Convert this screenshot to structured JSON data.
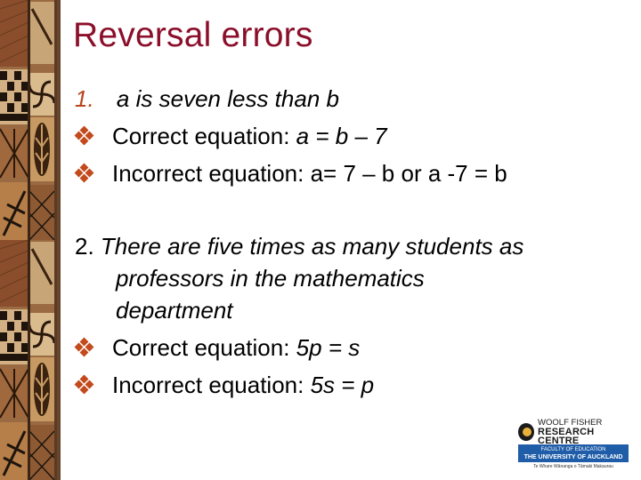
{
  "slide": {
    "title": "Reversal errors",
    "title_color": "#8b0f2a",
    "bullet_color": "#c24a1c",
    "item1": {
      "number": "1.",
      "statement": "a is seven less than b",
      "correct_label": "Correct equation: ",
      "correct_eq": "a = b – 7",
      "incorrect_label": "Incorrect equation: a= 7 – b or a -7 = b"
    },
    "item2": {
      "number": "2.",
      "statement_line1": "There are five times as many students as",
      "statement_line2": "professors in the mathematics",
      "statement_line3": "department",
      "correct_label": "Correct equation: ",
      "correct_eq": "5p = s",
      "incorrect_label": "Incorrect equation: ",
      "incorrect_eq": "5s = p"
    },
    "bullet_icon": "diamond-cluster-icon"
  },
  "logo": {
    "name_line1": "WOOLF FISHER",
    "name_line2": "RESEARCH CENTRE",
    "band_line1": "FACULTY OF EDUCATION",
    "band_line2": "THE UNIVERSITY OF AUCKLAND",
    "tagline": "Te Whare Wānanga o Tāmaki Makaurau",
    "band_color": "#1f5da8"
  }
}
